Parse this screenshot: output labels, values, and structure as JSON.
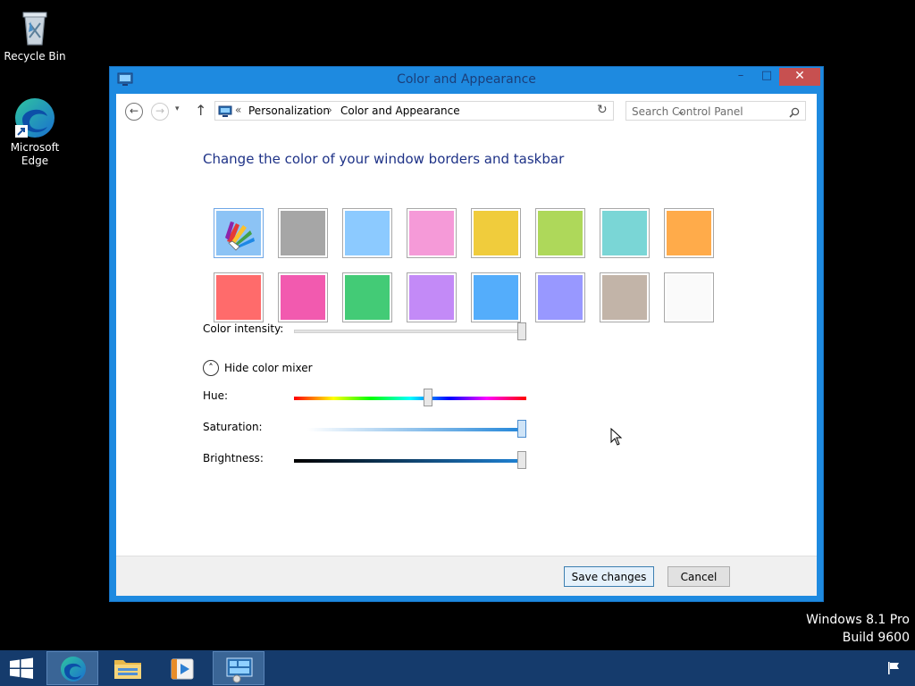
{
  "desktop": {
    "icons": [
      {
        "label": "Recycle Bin",
        "icon": "recycle-bin-icon"
      },
      {
        "label": "Microsoft Edge",
        "icon": "edge-icon"
      }
    ],
    "watermark": {
      "line1": "Windows 8.1 Pro",
      "line2": "Build 9600"
    }
  },
  "window": {
    "title": "Color and Appearance",
    "controls": {
      "minimize": "–",
      "maximize": "□",
      "close": "✕"
    },
    "nav": {
      "back": "←",
      "forward": "→",
      "recent": "▾",
      "up": "↑",
      "breadcrumb_prefix": "«",
      "breadcrumbs": [
        "Personalization",
        "Color and Appearance"
      ],
      "separator": "›",
      "dropdown": "⌄",
      "refresh": "↻",
      "search_placeholder": "Search Control Panel"
    },
    "heading": "Change the color of your window borders and taskbar",
    "swatches": [
      {
        "name": "automatic",
        "color": "#8cc3f5",
        "selected": true
      },
      {
        "name": "gray",
        "color": "#a6a6a6"
      },
      {
        "name": "light-blue",
        "color": "#8ccaff"
      },
      {
        "name": "pink",
        "color": "#f59ad8"
      },
      {
        "name": "yellow",
        "color": "#f0cc3c"
      },
      {
        "name": "lime",
        "color": "#aed85a"
      },
      {
        "name": "teal",
        "color": "#7ad6d6"
      },
      {
        "name": "orange",
        "color": "#ffab4a"
      },
      {
        "name": "red",
        "color": "#ff6b6b"
      },
      {
        "name": "magenta",
        "color": "#f25aaf"
      },
      {
        "name": "green",
        "color": "#43cb76"
      },
      {
        "name": "purple",
        "color": "#c38af7"
      },
      {
        "name": "blue",
        "color": "#54adfb"
      },
      {
        "name": "periwinkle",
        "color": "#9898ff"
      },
      {
        "name": "taupe",
        "color": "#c2b4a8"
      },
      {
        "name": "white",
        "color": "#fafafa"
      }
    ],
    "intensity_label": "Color intensity:",
    "intensity_value": 1.0,
    "mixer_toggle": "Hide color mixer",
    "mixer_toggle_icon": "˄",
    "hue_label": "Hue:",
    "hue_value": 0.58,
    "saturation_label": "Saturation:",
    "saturation_value": 1.0,
    "brightness_label": "Brightness:",
    "brightness_value": 1.0,
    "save_label": "Save changes",
    "cancel_label": "Cancel"
  },
  "taskbar": {
    "items": [
      "start-button",
      "edge",
      "file-explorer",
      "windows-media-player",
      "control-panel"
    ],
    "active": "control-panel"
  }
}
